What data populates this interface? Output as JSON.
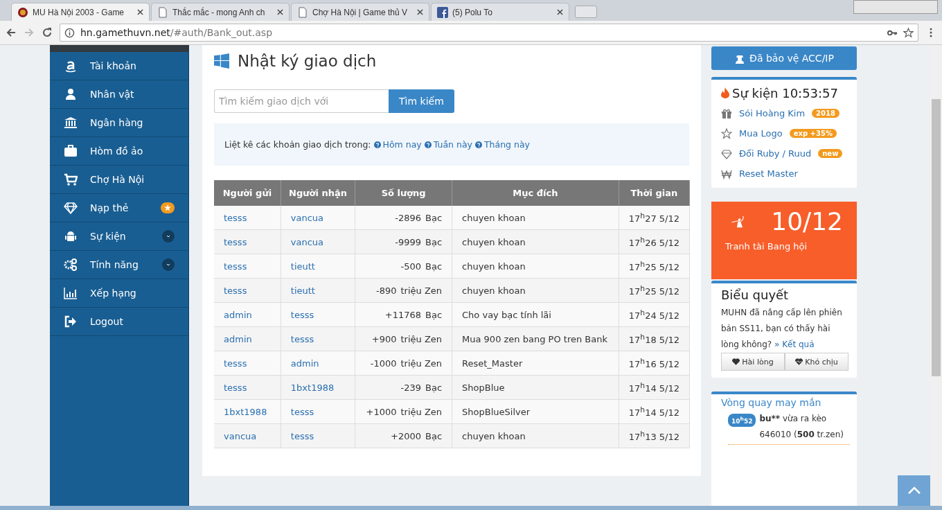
{
  "browser": {
    "tabs": [
      {
        "title": "MU Hà Nội 2003 - Game",
        "kind": "logo",
        "selected": true
      },
      {
        "title": "Thắc mắc - mong Anh ch",
        "kind": "page",
        "selected": false
      },
      {
        "title": "Chợ Hà Nội | Game thủ V",
        "kind": "page",
        "selected": false
      },
      {
        "title": "(5) Polu To",
        "kind": "facebook",
        "selected": false
      }
    ],
    "url_host": "hn.gamethuvn.net",
    "url_path": "/#auth/Bank_out.asp"
  },
  "sidebar": {
    "items": [
      {
        "label": "Tài khoản",
        "kind": "amazon",
        "expandable": false
      },
      {
        "label": "Nhân vật",
        "kind": "user",
        "expandable": false
      },
      {
        "label": "Ngân hàng",
        "kind": "bank",
        "expandable": false
      },
      {
        "label": "Hòm đồ ảo",
        "kind": "suitcase",
        "expandable": false
      },
      {
        "label": "Chợ Hà Nội",
        "kind": "cart",
        "expandable": false
      },
      {
        "label": "Nạp thẻ",
        "kind": "diamond",
        "expandable": false
      },
      {
        "label": "Sự kiện",
        "kind": "android",
        "expandable": true
      },
      {
        "label": "Tính năng",
        "kind": "gears",
        "expandable": true
      },
      {
        "label": "Xếp hạng",
        "kind": "chart",
        "expandable": false
      },
      {
        "label": "Logout",
        "kind": "logout",
        "expandable": false
      }
    ]
  },
  "main": {
    "title": "Nhật ký giao dịch",
    "search": {
      "placeholder": "Tìm kiếm giao dịch với",
      "button": "Tìm kiếm"
    },
    "filter": {
      "label": "Liệt kê các khoản giao dịch trong:",
      "links": [
        "Hôm nay",
        "Tuần này",
        "Tháng này"
      ]
    },
    "table": {
      "columns": [
        "Người gửi",
        "Người nhận",
        "Số lượng",
        "Mục đích",
        "Thời gian"
      ],
      "rows": [
        {
          "sender": "tesss",
          "receiver": "vancua",
          "amount": "-2896",
          "unit": "Bạc",
          "purpose": "chuyen khoan",
          "time": "17$^{h}$27 5/12"
        },
        {
          "sender": "tesss",
          "receiver": "vancua",
          "amount": "-9999",
          "unit": "Bạc",
          "purpose": "chuyen khoan",
          "time": "17$^{h}$26 5/12"
        },
        {
          "sender": "tesss",
          "receiver": "tieutt",
          "amount": "-500",
          "unit": "Bạc",
          "purpose": "chuyen khoan",
          "time": "17$^{h}$25 5/12"
        },
        {
          "sender": "tesss",
          "receiver": "tieutt",
          "amount": "-890",
          "unit": "triệu Zen",
          "purpose": "chuyen khoan",
          "time": "17$^{h}$25 5/12"
        },
        {
          "sender": "admin",
          "receiver": "tesss",
          "amount": "+11768",
          "unit": "Bạc",
          "purpose": "Cho vay bạc tính lãi",
          "time": "17$^{h}$24 5/12"
        },
        {
          "sender": "admin",
          "receiver": "tesss",
          "amount": "+900",
          "unit": "triệu Zen",
          "purpose": "Mua 900 zen bang PO tren Bank",
          "time": "17$^{h}$18 5/12"
        },
        {
          "sender": "tesss",
          "receiver": "admin",
          "amount": "-1000",
          "unit": "triệu Zen",
          "purpose": "Reset_Master",
          "time": "17$^{h}$16 5/12"
        },
        {
          "sender": "tesss",
          "receiver": "1bxt1988",
          "amount": "-239",
          "unit": "Bạc",
          "purpose": "ShopBlue",
          "time": "17$^{h}$14 5/12"
        },
        {
          "sender": "1bxt1988",
          "receiver": "tesss",
          "amount": "+1000",
          "unit": "triệu Zen",
          "purpose": "ShopBlueSilver",
          "time": "17$^{h}$14 5/12"
        },
        {
          "sender": "vancua",
          "receiver": "tesss",
          "amount": "+2000",
          "unit": "Bạc",
          "purpose": "chuyen khoan",
          "time": "17$^{h}$13 5/12"
        }
      ]
    }
  },
  "right": {
    "protect_button": "Đã bảo vệ ACC/IP",
    "events": {
      "title": "Sự kiện 10:53:57",
      "items": [
        {
          "label": "Sói Hoàng Kim",
          "kind": "gift",
          "tag": "2018"
        },
        {
          "label": "Mua Logo",
          "kind": "star",
          "tag": "exp +35%"
        },
        {
          "label": "Đổi Ruby / Ruud",
          "kind": "diamond",
          "tag": "new"
        },
        {
          "label": "Reset Master",
          "kind": "won"
        }
      ]
    },
    "guild": {
      "date": "10/12",
      "label": "Tranh tài Bang hội"
    },
    "poll": {
      "title": "Biểu quyết",
      "question": "MUHN đã nâng cấp lên phiên bản SS11, bạn có thấy hài lòng không?",
      "result_link": "» Kết quả",
      "buttons": [
        {
          "label": "Hài lòng",
          "kind": "heart"
        },
        {
          "label": "Khó chịu",
          "kind": "heartbeat"
        }
      ]
    },
    "wheel": {
      "title": "Vòng quay may mắn",
      "time": "10$^{h}$52",
      "user": "bu**",
      "message": "vừa ra kèo 646010 (**500** tr.zen)"
    }
  }
}
